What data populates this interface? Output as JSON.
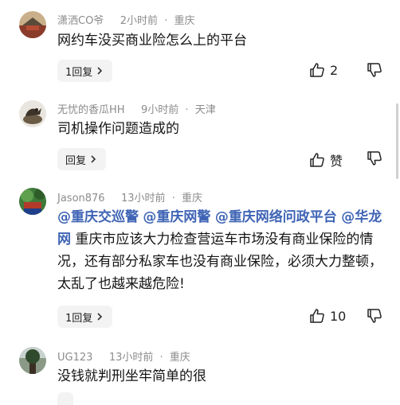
{
  "comments": [
    {
      "user": "潇洒CO爷",
      "time": "2小时前",
      "location": "重庆",
      "text": "网约车没买商业险怎么上的平台",
      "reply_label": "1回复",
      "like_count": "2"
    },
    {
      "user": "无忧的香瓜HH",
      "time": "9小时前",
      "location": "天津",
      "text": "司机操作问题造成的",
      "reply_label": "回复",
      "like_count": "赞"
    },
    {
      "user": "Jason876",
      "time": "13小时前",
      "location": "重庆",
      "mentions": [
        "@重庆交巡警",
        "@重庆网警",
        "@重庆网络问政平台",
        "@华龙网"
      ],
      "text": "重庆市应该大力检查营运车市场没有商业保险的情况，还有部分私家车也没有商业保险，必须大力整顿，太乱了也越来越危险!",
      "reply_label": "1回复",
      "like_count": "10"
    },
    {
      "user": "UG123",
      "time": "13小时前",
      "location": "重庆",
      "text": "没钱就判刑坐牢简单的很"
    }
  ],
  "separator": "·",
  "colors": {
    "mention": "#3f64b5",
    "meta": "#8c8c8c",
    "button_bg": "#f3f3f3"
  },
  "icons": {
    "like": "thumbs-up-icon",
    "dislike": "thumbs-down-icon",
    "reply": "chevron-right-icon"
  }
}
